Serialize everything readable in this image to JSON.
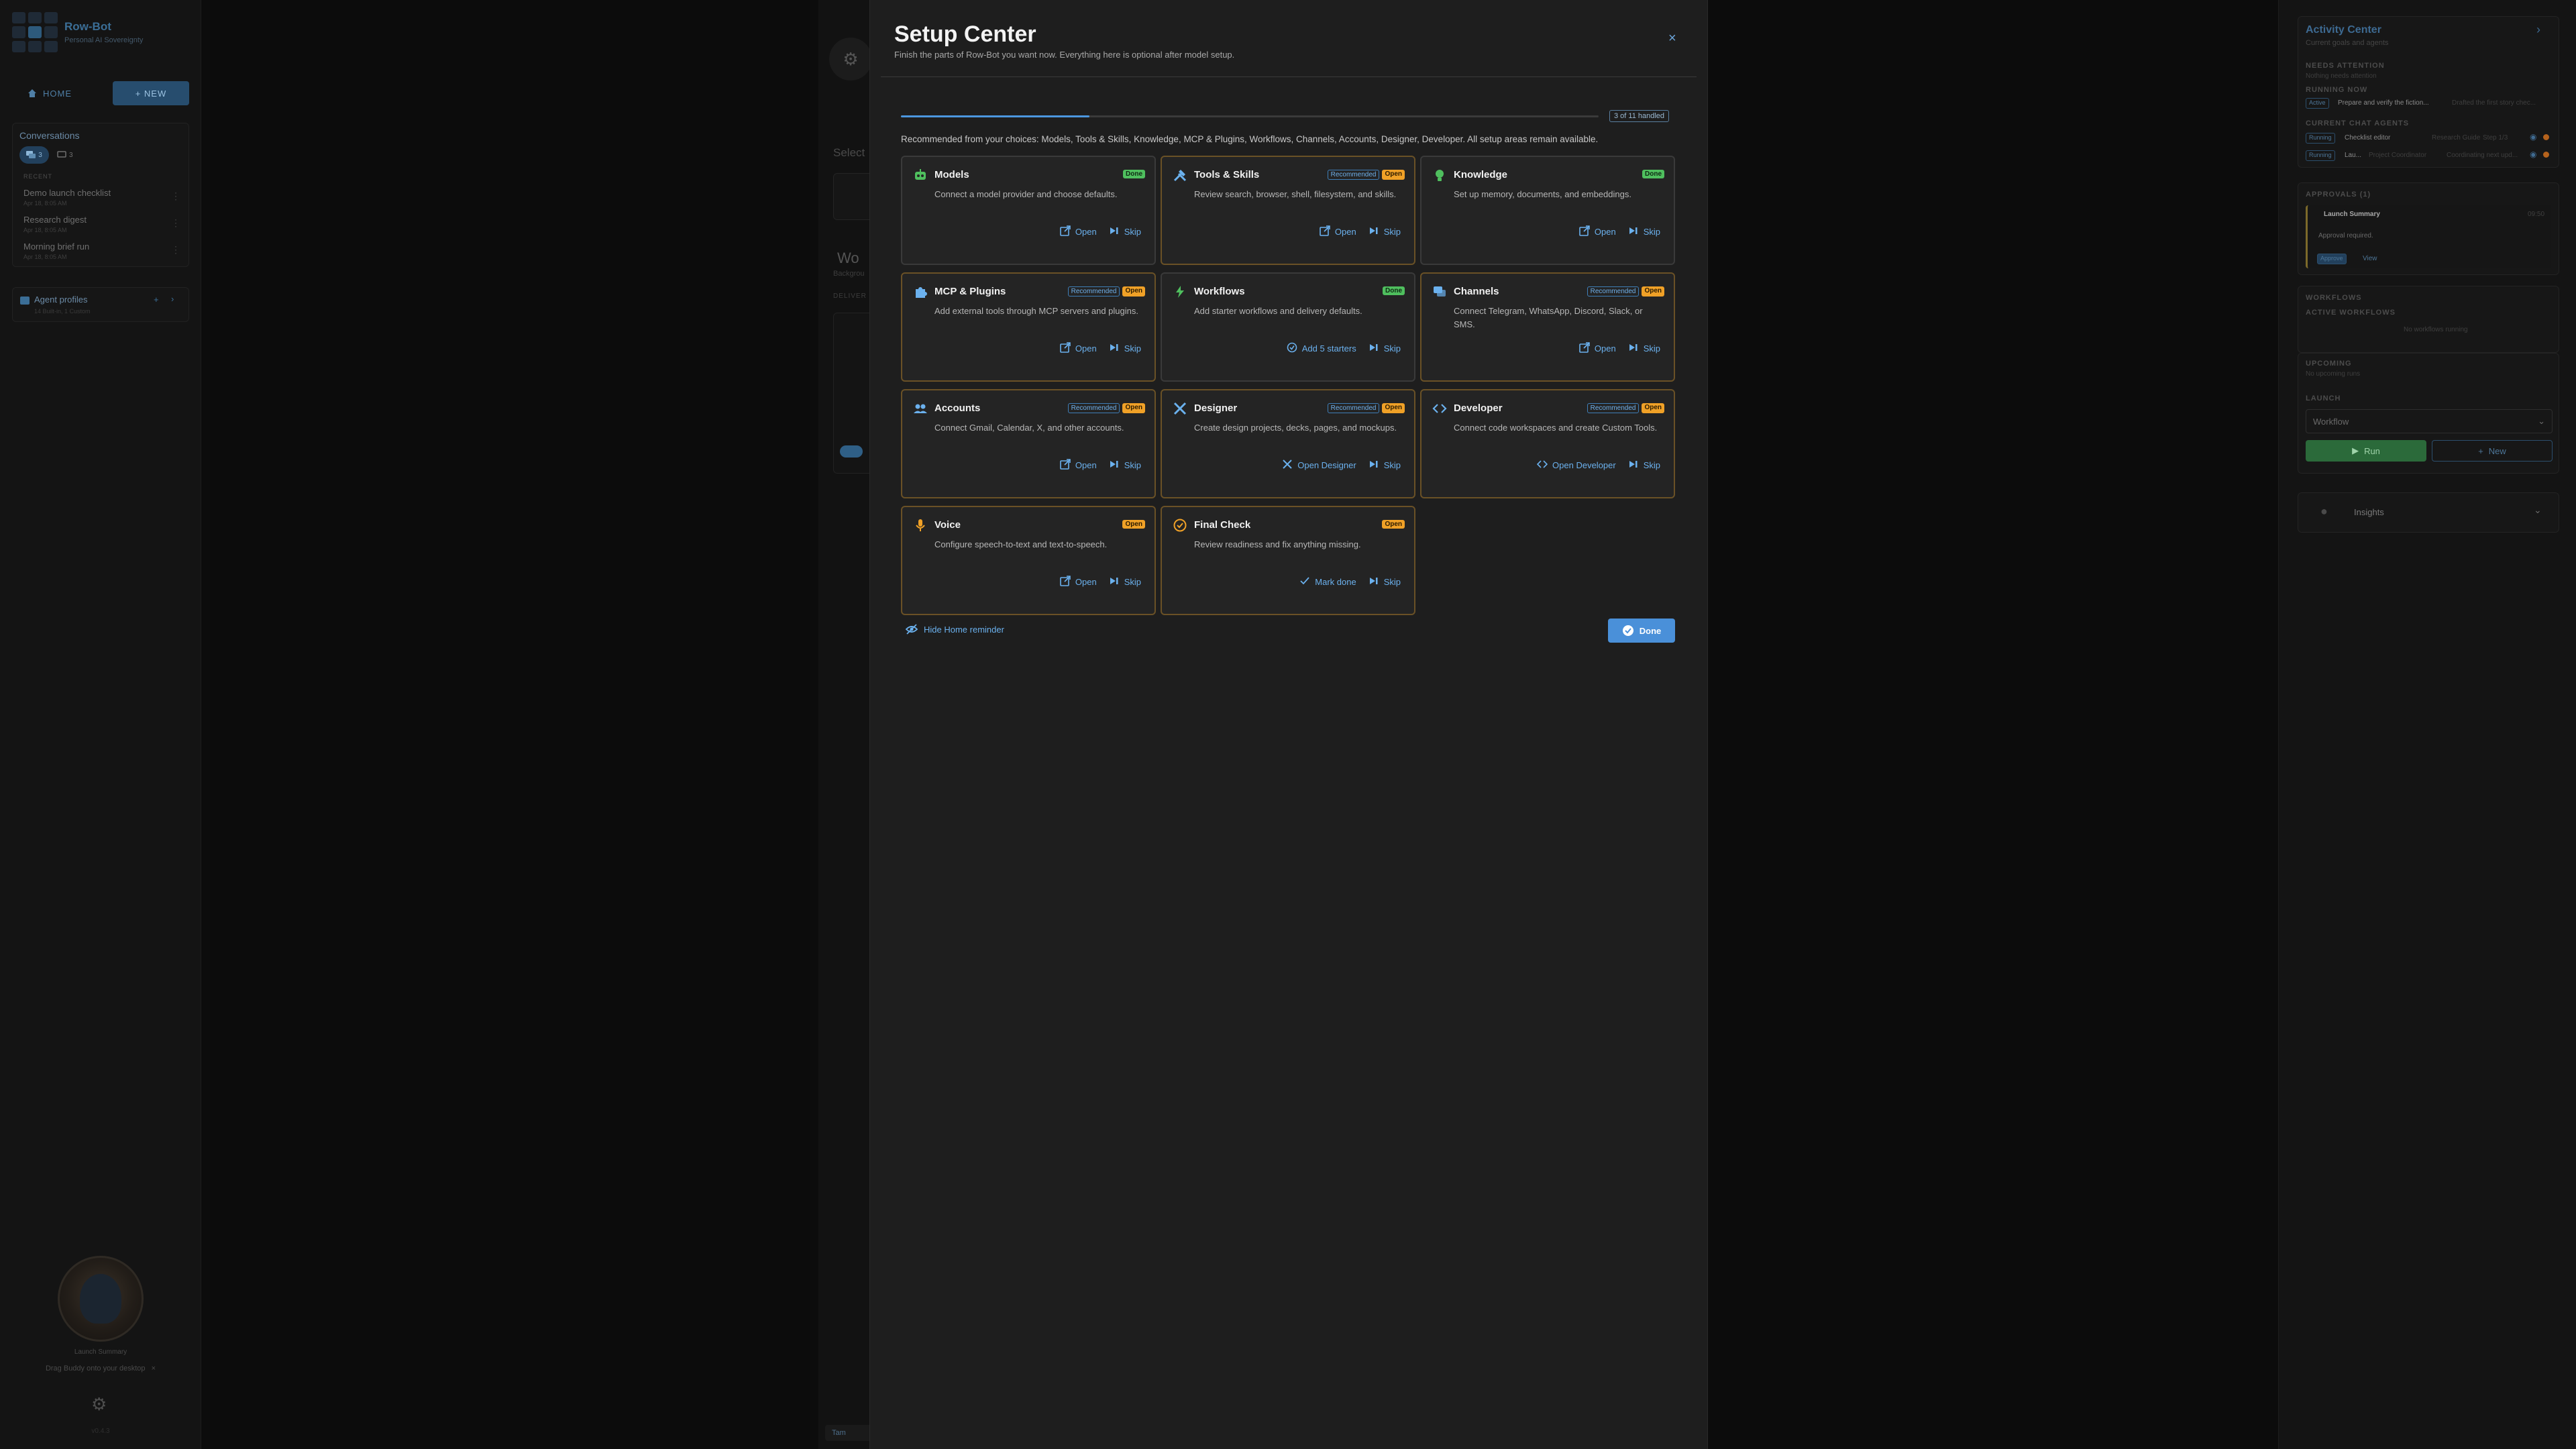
{
  "sidebar": {
    "brand_name": "Row-Bot",
    "brand_tagline": "Personal AI Sovereignty",
    "home_label": "HOME",
    "new_label": "+ NEW",
    "conversations_title": "Conversations",
    "tab_chats_count": "3",
    "tab_messages_count": "3",
    "recent_label": "RECENT",
    "conversations": [
      {
        "title": "Demo launch checklist",
        "date": "Apr 18, 8:05 AM"
      },
      {
        "title": "Research digest",
        "date": "Apr 18, 8:05 AM"
      },
      {
        "title": "Morning brief run",
        "date": "Apr 18, 8:05 AM"
      }
    ],
    "agent_profiles_title": "Agent profiles",
    "agent_profiles_sub": "14 Built-in, 1 Custom",
    "avatar_label": "Launch Summary",
    "buddy_tip": "Drag Buddy onto your desktop",
    "version": "v0.4.3"
  },
  "main_bg": {
    "select_label": "Select",
    "workflow_title": "Wo",
    "background_label": "Backgrou",
    "deliver_label": "DELIVER",
    "footer_label": "Tam"
  },
  "modal": {
    "title": "Setup Center",
    "subtitle": "Finish the parts of Row-Bot you want now. Everything here is optional after model setup.",
    "close_icon": "×",
    "progress_fraction": 0.27,
    "progress_label": "3 of 11 handled",
    "recommendation": "Recommended from your choices: Models, Tools & Skills, Knowledge, MCP & Plugins, Workflows, Channels, Accounts, Designer, Developer. All setup areas remain available.",
    "hide_reminder": "Hide Home reminder",
    "done_label": "Done",
    "cards": [
      {
        "title": "Models",
        "desc": "Connect a model provider and choose defaults.",
        "recommended": "",
        "status": "Done",
        "primary": "Open",
        "skip": "Skip",
        "icon": "robot-icon",
        "color": "#4fbf5e"
      },
      {
        "title": "Tools & Skills",
        "desc": "Review search, browser, shell, filesystem, and skills.",
        "recommended": "Recommended",
        "status": "Open",
        "primary": "Open",
        "skip": "Skip",
        "icon": "tools-icon",
        "color": "#6bb1ee"
      },
      {
        "title": "Knowledge",
        "desc": "Set up memory, documents, and embeddings.",
        "recommended": "",
        "status": "Done",
        "primary": "Open",
        "skip": "Skip",
        "icon": "bulb-icon",
        "color": "#4fbf5e"
      },
      {
        "title": "MCP & Plugins",
        "desc": "Add external tools through MCP servers and plugins.",
        "recommended": "Recommended",
        "status": "Open",
        "primary": "Open",
        "skip": "Skip",
        "icon": "puzzle-icon",
        "color": "#6bb1ee"
      },
      {
        "title": "Workflows",
        "desc": "Add starter workflows and delivery defaults.",
        "recommended": "",
        "status": "Done",
        "primary": "Add 5 starters",
        "skip": "Skip",
        "icon": "bolt-icon",
        "color": "#4fbf5e"
      },
      {
        "title": "Channels",
        "desc": "Connect Telegram, WhatsApp, Discord, Slack, or SMS.",
        "recommended": "Recommended",
        "status": "Open",
        "primary": "Open",
        "skip": "Skip",
        "icon": "chat-icon",
        "color": "#6bb1ee"
      },
      {
        "title": "Accounts",
        "desc": "Connect Gmail, Calendar, X, and other accounts.",
        "recommended": "Recommended",
        "status": "Open",
        "primary": "Open",
        "skip": "Skip",
        "icon": "people-icon",
        "color": "#6bb1ee"
      },
      {
        "title": "Designer",
        "desc": "Create design projects, decks, pages, and mockups.",
        "recommended": "Recommended",
        "status": "Open",
        "primary": "Open Designer",
        "skip": "Skip",
        "icon": "design-icon",
        "color": "#6bb1ee"
      },
      {
        "title": "Developer",
        "desc": "Connect code workspaces and create Custom Tools.",
        "recommended": "Recommended",
        "status": "Open",
        "primary": "Open Developer",
        "skip": "Skip",
        "icon": "code-icon",
        "color": "#6bb1ee"
      },
      {
        "title": "Voice",
        "desc": "Configure speech-to-text and text-to-speech.",
        "recommended": "",
        "status": "Open",
        "primary": "Open",
        "skip": "Skip",
        "icon": "mic-icon",
        "color": "#f0a127"
      },
      {
        "title": "Final Check",
        "desc": "Review readiness and fix anything missing.",
        "recommended": "",
        "status": "Open",
        "primary": "Mark done",
        "skip": "Skip",
        "icon": "check-circle-icon",
        "color": "#f0a127"
      }
    ]
  },
  "activity": {
    "title": "Activity Center",
    "subtitle": "Current goals and agents",
    "needs_attention": "NEEDS ATTENTION",
    "needs_attention_sub": "Nothing needs attention",
    "running_now": "RUNNING NOW",
    "running_chip": "Active",
    "running_text": "Prepare and verify the fiction...",
    "running_note": "Drafted the first story chec...",
    "current_agents": "CURRENT CHAT AGENTS",
    "agents": [
      {
        "chip": "Running",
        "name": "Checklist editor",
        "role": "Research Guide",
        "note": "Step 1/3"
      },
      {
        "chip": "Running",
        "name": "Lau...",
        "role": "Project Coordinator",
        "note": "Coordinating next upd..."
      }
    ],
    "approvals_title": "APPROVALS (1)",
    "approval_name": "Launch Summary",
    "approval_time": "09:50",
    "approval_text": "Approval required.",
    "approval_approve": "Approve",
    "approval_view": "View",
    "workflows_title": "WORKFLOWS",
    "active_workflows": "ACTIVE WORKFLOWS",
    "no_workflows": "No workflows running",
    "upcoming": "UPCOMING",
    "upcoming_sub": "No upcoming runs",
    "launch": "LAUNCH",
    "workflow_select": "Workflow",
    "run_label": "Run",
    "new_label": "New",
    "insights": "Insights"
  }
}
